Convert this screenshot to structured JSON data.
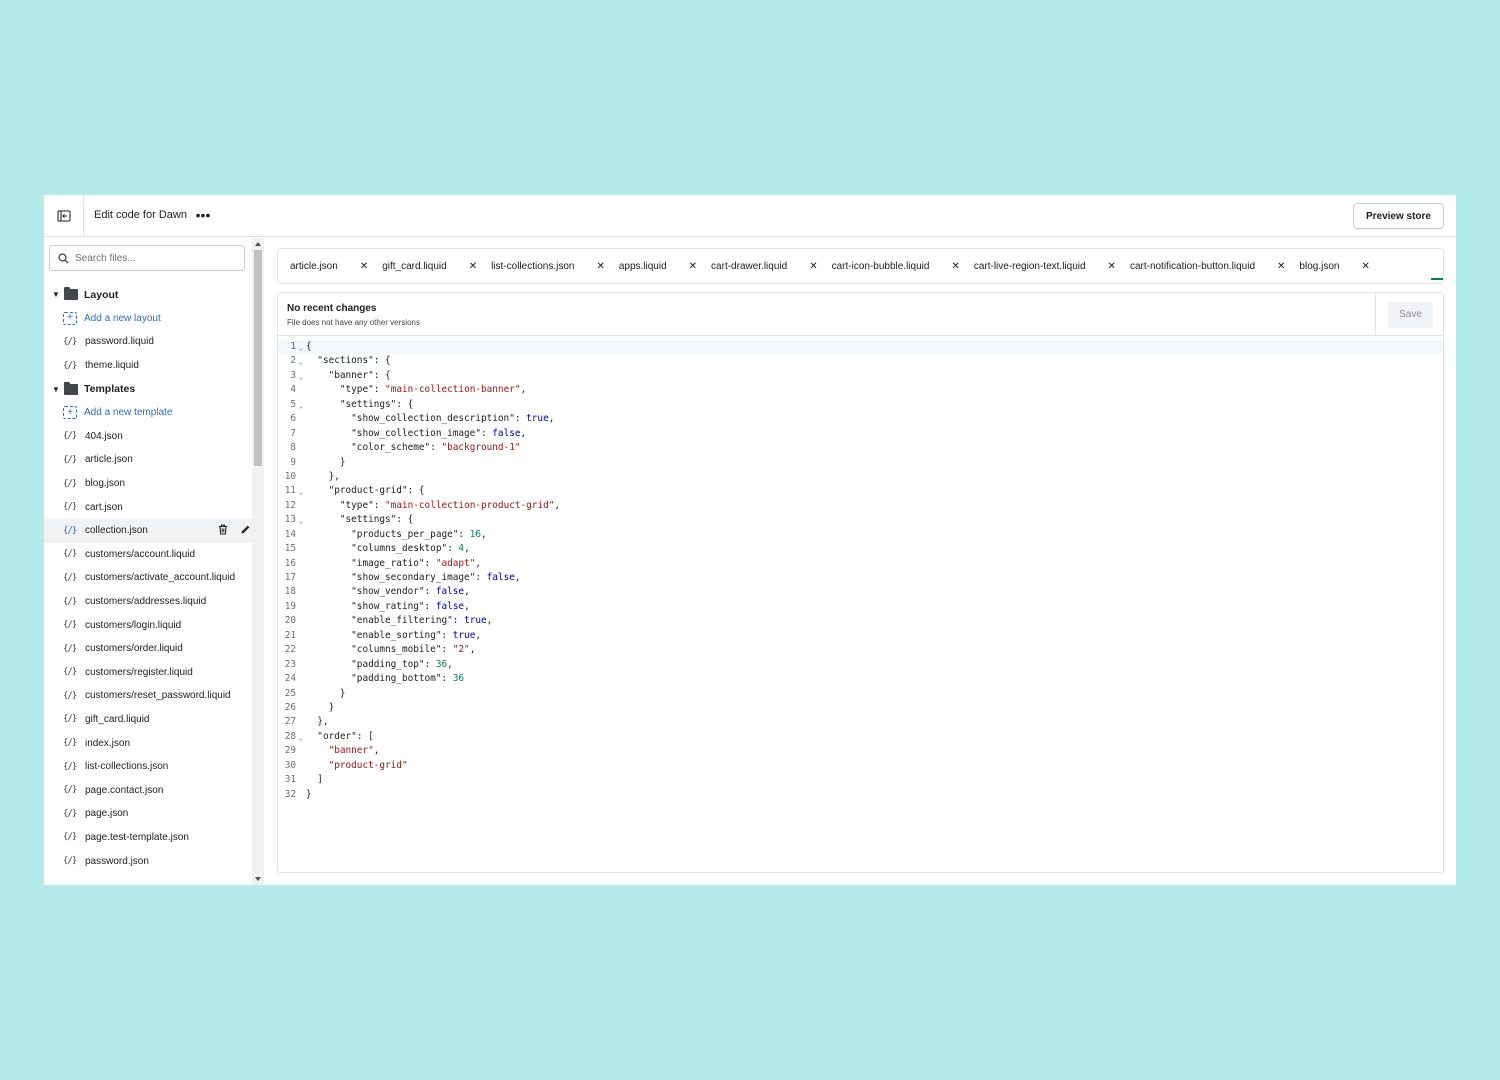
{
  "topbar": {
    "title": "Edit code for Dawn",
    "more_label": "•••",
    "preview_label": "Preview store"
  },
  "sidebar": {
    "search_placeholder": "Search files...",
    "layout": {
      "label": "Layout",
      "add_label": "Add a new layout",
      "files": [
        "password.liquid",
        "theme.liquid"
      ]
    },
    "templates": {
      "label": "Templates",
      "add_label": "Add a new template",
      "files": [
        "404.json",
        "article.json",
        "blog.json",
        "cart.json",
        "collection.json",
        "customers/account.liquid",
        "customers/activate_account.liquid",
        "customers/addresses.liquid",
        "customers/login.liquid",
        "customers/order.liquid",
        "customers/register.liquid",
        "customers/reset_password.liquid",
        "gift_card.liquid",
        "index.json",
        "list-collections.json",
        "page.contact.json",
        "page.json",
        "page.test-template.json",
        "password.json"
      ]
    },
    "selected_file": "collection.json"
  },
  "tabs": [
    {
      "label": "article.json"
    },
    {
      "label": "gift_card.liquid"
    },
    {
      "label": "list-collections.json"
    },
    {
      "label": "apps.liquid"
    },
    {
      "label": "cart-drawer.liquid"
    },
    {
      "label": "cart-icon-bubble.liquid"
    },
    {
      "label": "cart-live-region-text.liquid"
    },
    {
      "label": "cart-notification-button.liquid"
    },
    {
      "label": "blog.json"
    }
  ],
  "panel": {
    "title": "No recent changes",
    "subtitle": "File does not have any other versions",
    "save_label": "Save"
  },
  "code_lines": [
    "{",
    "  \"sections\": {",
    "    \"banner\": {",
    "      \"type\": \"main-collection-banner\",",
    "      \"settings\": {",
    "        \"show_collection_description\": true,",
    "        \"show_collection_image\": false,",
    "        \"color_scheme\": \"background-1\"",
    "      }",
    "    },",
    "    \"product-grid\": {",
    "      \"type\": \"main-collection-product-grid\",",
    "      \"settings\": {",
    "        \"products_per_page\": 16,",
    "        \"columns_desktop\": 4,",
    "        \"image_ratio\": \"adapt\",",
    "        \"show_secondary_image\": false,",
    "        \"show_vendor\": false,",
    "        \"show_rating\": false,",
    "        \"enable_filtering\": true,",
    "        \"enable_sorting\": true,",
    "        \"columns_mobile\": \"2\",",
    "        \"padding_top\": 36,",
    "        \"padding_bottom\": 36",
    "      }",
    "    }",
    "  },",
    "  \"order\": [",
    "    \"banner\",",
    "    \"product-grid\"",
    "  ]",
    "}"
  ],
  "foldable_lines": [
    1,
    2,
    3,
    5,
    11,
    13,
    28
  ],
  "colors": {
    "accent_blue": "#2c6ecb",
    "accent_green": "#008060",
    "string": "#a31515",
    "keyword": "#0000c0",
    "number": "#0a7c5b"
  }
}
